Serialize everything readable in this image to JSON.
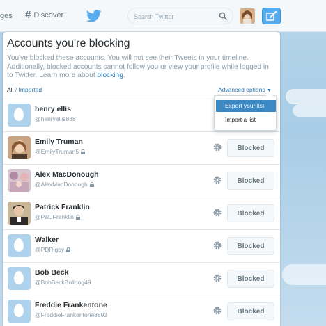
{
  "topbar": {
    "messages_label": "ges",
    "discover_label": "Discover",
    "search_placeholder": "Search Twitter"
  },
  "page": {
    "title": "Accounts you're blocking",
    "description": "You've blocked these accounts. You will not see their Tweets in your timeline. Additionally, blocked accounts cannot follow you or view your profile while logged in to Twitter. Learn more about",
    "learn_link": "blocking",
    "description_end": ".",
    "filter_all": "All",
    "filter_sep": " / ",
    "filter_imported": "Imported",
    "advanced_options": "Advanced options"
  },
  "dropdown": {
    "items": [
      {
        "label": "Export your list"
      },
      {
        "label": "Import a list"
      }
    ]
  },
  "accounts": [
    {
      "name": "henry ellis",
      "handle": "@henryellis888"
    },
    {
      "name": "Emily Truman",
      "handle": "@EmilyTruman5",
      "blocked_label": "Blocked"
    },
    {
      "name": "Alex MacDonough",
      "handle": "@AlexMacDonough",
      "blocked_label": "Blocked"
    },
    {
      "name": "Patrick Franklin",
      "handle": "@PatJFranklin",
      "blocked_label": "Blocked"
    },
    {
      "name": "Walker",
      "handle": "@PDRigby",
      "blocked_label": "Blocked"
    },
    {
      "name": "Bob Beck",
      "handle": "@BobBeckBulldog49",
      "blocked_label": "Blocked"
    },
    {
      "name": "Freddie Frankentone",
      "handle": "@FreddieFrankentone8893",
      "blocked_label": "Blocked"
    }
  ],
  "colors": {
    "accent": "#55acee",
    "link": "#2b7bb9",
    "dropdown_active": "#3b88c3",
    "default_avatar": "#aed1ec"
  }
}
